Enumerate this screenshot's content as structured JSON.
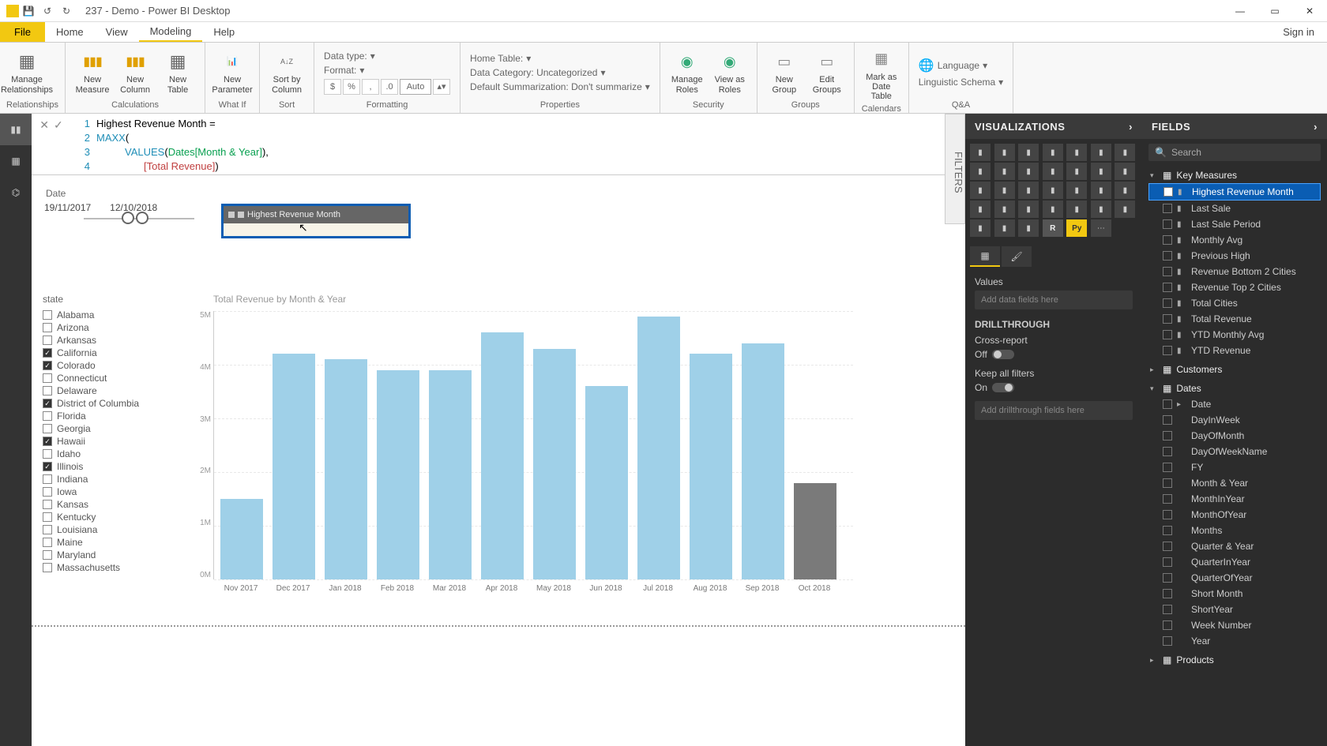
{
  "app": {
    "title": "237 - Demo - Power BI Desktop",
    "signin": "Sign in"
  },
  "menu": {
    "file": "File",
    "items": [
      "Home",
      "View",
      "Modeling",
      "Help"
    ],
    "active": "Modeling"
  },
  "ribbon": {
    "calculations": {
      "label": "Calculations",
      "manage_rel": "Manage\nRelationships",
      "rel_group": "Relationships",
      "new_measure": "New\nMeasure",
      "new_column": "New\nColumn",
      "new_table": "New\nTable"
    },
    "whatif": {
      "label": "What If",
      "new_param": "New\nParameter"
    },
    "sort": {
      "label": "Sort",
      "sort_by": "Sort by\nColumn"
    },
    "formatting": {
      "label": "Formatting",
      "datatype": "Data type:",
      "format": "Format:",
      "auto": "Auto"
    },
    "properties": {
      "label": "Properties",
      "home_table": "Home Table:",
      "data_cat": "Data Category: Uncategorized",
      "summ": "Default Summarization: Don't summarize"
    },
    "security": {
      "label": "Security",
      "manage_roles": "Manage\nRoles",
      "view_as": "View as\nRoles"
    },
    "groups": {
      "label": "Groups",
      "new_group": "New\nGroup",
      "edit_groups": "Edit\nGroups"
    },
    "calendars": {
      "label": "Calendars",
      "mark_date": "Mark as\nDate Table"
    },
    "qa": {
      "label": "Q&A",
      "language": "Language",
      "schema": "Linguistic Schema"
    }
  },
  "formula": {
    "l1": "Highest Revenue Month =",
    "l2_kw": "MAXX",
    "l2_rest": "(",
    "l3_kw": "VALUES",
    "l3_col": "Dates[Month & Year]",
    "l3_rest": " ),",
    "l4_meas": "[Total Revenue]",
    "l4_rest": " )"
  },
  "date_slicer": {
    "label": "Date",
    "start": "19/11/2017",
    "end": "12/10/2018"
  },
  "card": {
    "title": "Highest Revenue Month"
  },
  "state_slicer": {
    "title": "state",
    "items": [
      {
        "name": "Alabama",
        "checked": false
      },
      {
        "name": "Arizona",
        "checked": false
      },
      {
        "name": "Arkansas",
        "checked": false
      },
      {
        "name": "California",
        "checked": true
      },
      {
        "name": "Colorado",
        "checked": true
      },
      {
        "name": "Connecticut",
        "checked": false
      },
      {
        "name": "Delaware",
        "checked": false
      },
      {
        "name": "District of Columbia",
        "checked": true
      },
      {
        "name": "Florida",
        "checked": false
      },
      {
        "name": "Georgia",
        "checked": false
      },
      {
        "name": "Hawaii",
        "checked": true
      },
      {
        "name": "Idaho",
        "checked": false
      },
      {
        "name": "Illinois",
        "checked": true
      },
      {
        "name": "Indiana",
        "checked": false
      },
      {
        "name": "Iowa",
        "checked": false
      },
      {
        "name": "Kansas",
        "checked": false
      },
      {
        "name": "Kentucky",
        "checked": false
      },
      {
        "name": "Louisiana",
        "checked": false
      },
      {
        "name": "Maine",
        "checked": false
      },
      {
        "name": "Maryland",
        "checked": false
      },
      {
        "name": "Massachusetts",
        "checked": false
      }
    ]
  },
  "chart_data": {
    "type": "bar",
    "title": "Total Revenue by Month & Year",
    "ylabel": "",
    "xlabel": "",
    "ylim": [
      0,
      5
    ],
    "y_ticks": [
      "5M",
      "4M",
      "3M",
      "2M",
      "1M",
      "0M"
    ],
    "categories": [
      "Nov 2017",
      "Dec 2017",
      "Jan 2018",
      "Feb 2018",
      "Mar 2018",
      "Apr 2018",
      "May 2018",
      "Jun 2018",
      "Jul 2018",
      "Aug 2018",
      "Sep 2018",
      "Oct 2018"
    ],
    "values": [
      1.5,
      4.2,
      4.1,
      3.9,
      3.9,
      4.6,
      4.3,
      3.6,
      4.9,
      4.2,
      4.4,
      1.8
    ],
    "dim_last": true
  },
  "filters_tab": "FILTERS",
  "viz_panel": {
    "title": "VISUALIZATIONS",
    "values": "Values",
    "values_placeholder": "Add data fields here",
    "drill": "DRILLTHROUGH",
    "cross": "Cross-report",
    "off": "Off",
    "keep": "Keep all filters",
    "on": "On",
    "drill_placeholder": "Add drillthrough fields here"
  },
  "fields_panel": {
    "title": "FIELDS",
    "search": "Search",
    "tables": [
      {
        "name": "Key Measures",
        "expanded": true,
        "fields": [
          {
            "name": "Highest Revenue Month",
            "selected": true,
            "measure": true
          },
          {
            "name": "Last Sale",
            "measure": true
          },
          {
            "name": "Last Sale Period",
            "measure": true
          },
          {
            "name": "Monthly Avg",
            "measure": true
          },
          {
            "name": "Previous High",
            "measure": true
          },
          {
            "name": "Revenue Bottom 2 Cities",
            "measure": true
          },
          {
            "name": "Revenue Top 2 Cities",
            "measure": true
          },
          {
            "name": "Total Cities",
            "measure": true
          },
          {
            "name": "Total Revenue",
            "measure": true
          },
          {
            "name": "YTD Monthly Avg",
            "measure": true
          },
          {
            "name": "YTD Revenue",
            "measure": true
          }
        ]
      },
      {
        "name": "Customers",
        "expanded": false
      },
      {
        "name": "Dates",
        "expanded": true,
        "fields": [
          {
            "name": "Date",
            "hier": true
          },
          {
            "name": "DayInWeek"
          },
          {
            "name": "DayOfMonth"
          },
          {
            "name": "DayOfWeekName"
          },
          {
            "name": "FY"
          },
          {
            "name": "Month & Year"
          },
          {
            "name": "MonthInYear"
          },
          {
            "name": "MonthOfYear"
          },
          {
            "name": "Months"
          },
          {
            "name": "Quarter & Year"
          },
          {
            "name": "QuarterInYear"
          },
          {
            "name": "QuarterOfYear"
          },
          {
            "name": "Short Month"
          },
          {
            "name": "ShortYear"
          },
          {
            "name": "Week Number"
          },
          {
            "name": "Year"
          }
        ]
      },
      {
        "name": "Products",
        "expanded": false
      }
    ]
  }
}
